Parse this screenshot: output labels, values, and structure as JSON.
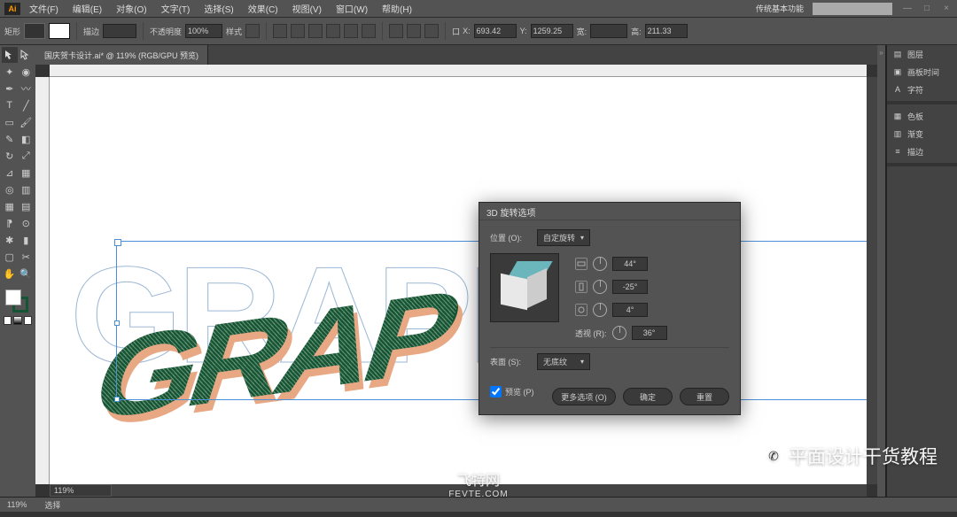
{
  "app": {
    "logo": "Ai",
    "workspace": "传统基本功能"
  },
  "menu": [
    "文件(F)",
    "编辑(E)",
    "对象(O)",
    "文字(T)",
    "选择(S)",
    "效果(C)",
    "视图(V)",
    "窗口(W)",
    "帮助(H)"
  ],
  "win": {
    "min": "—",
    "max": "□",
    "close": "×"
  },
  "toolbar": {
    "label1": "矩形",
    "label2": "填",
    "label3": "描边",
    "stroke_w": "",
    "opacity_label": "不透明度",
    "opacity": "100%",
    "style_label": "样式",
    "coord_x_label": "X:",
    "coord_x": "693.42",
    "coord_y_label": "Y:",
    "coord_y": "1259.25",
    "w_label": "宽:",
    "w": "",
    "h_label": "高:",
    "h": "211.33"
  },
  "doc_tab": "国庆贺卡设计.ai* @ 119% (RGB/GPU 预览)",
  "zoom": "119%",
  "artwork": {
    "text": "GRAPHIC",
    "main_partial": "GRAP"
  },
  "dialog": {
    "title": "3D 旋转选项",
    "position_label": "位置 (O):",
    "position_value": "自定旋转",
    "angle_x": "44°",
    "angle_y": "-25°",
    "angle_z": "4°",
    "perspective_label": "透视 (R):",
    "perspective_value": "36°",
    "surface_label": "表面 (S):",
    "surface_value": "无底纹",
    "preview": "预览 (P)",
    "btn_more": "更多选项 (O)",
    "btn_ok": "确定",
    "btn_reset": "重置"
  },
  "right_panel": {
    "groups": [
      [
        "图层",
        "画板时间",
        "字符"
      ],
      [
        "色板",
        "渐变",
        "描边"
      ]
    ]
  },
  "status": {
    "sel": "选择"
  },
  "watermarks": {
    "center": "飞特网",
    "center_sub": "FEVTE.COM",
    "right": "平面设计干货教程"
  }
}
